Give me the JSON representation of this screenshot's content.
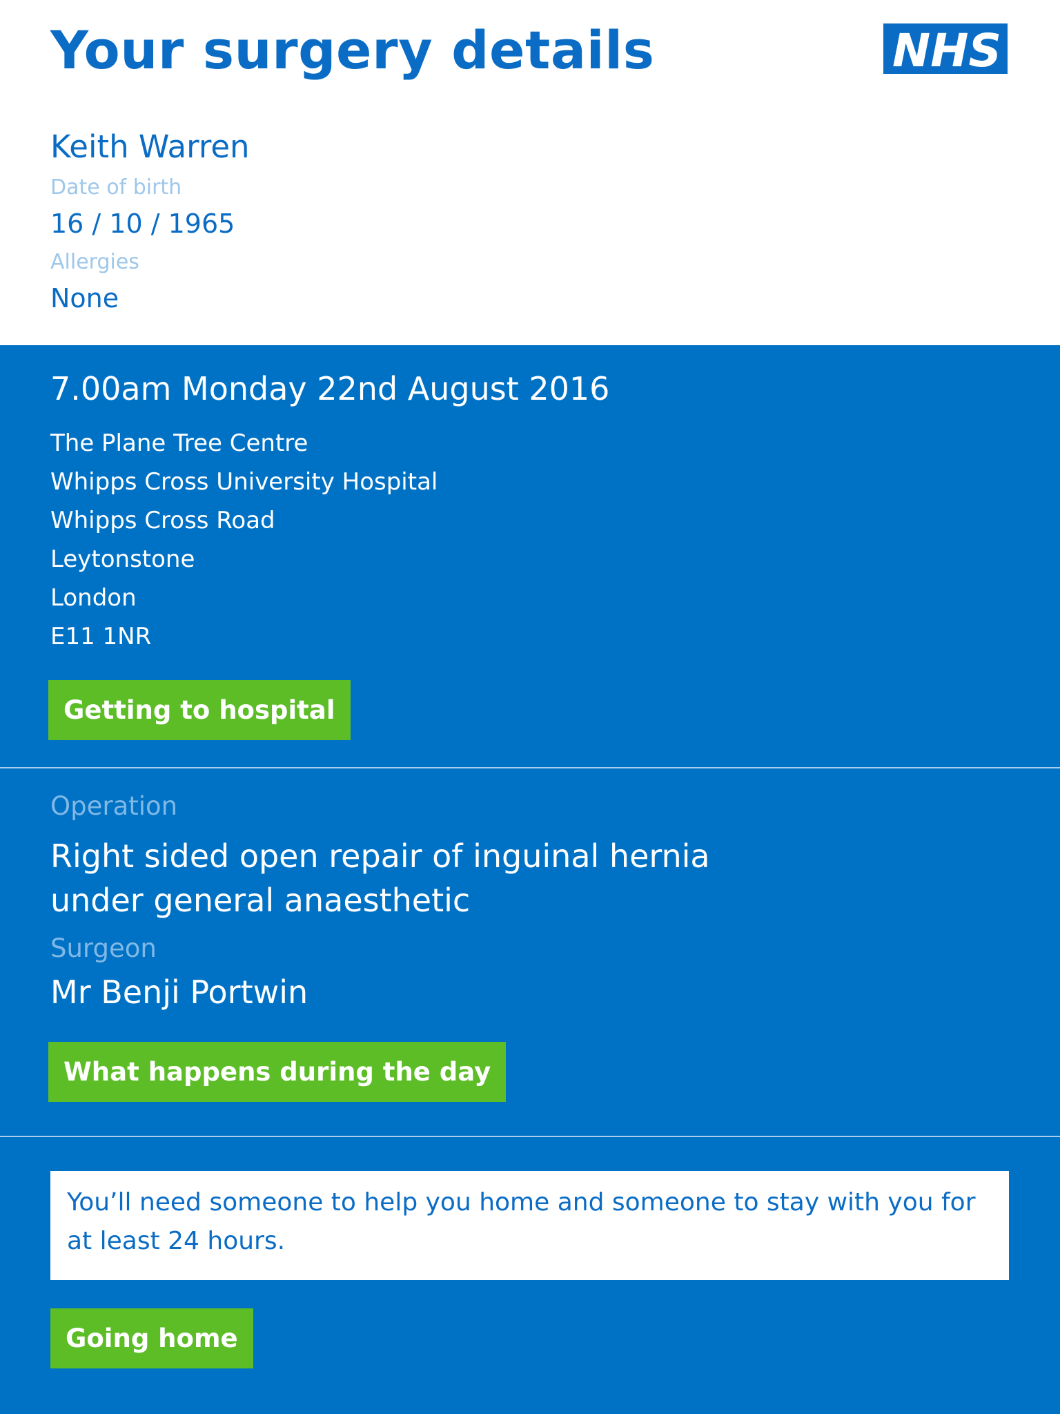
{
  "header": {
    "title": "Your surgery details",
    "logo_text": "NHS"
  },
  "patient": {
    "name": "Keith Warren",
    "dob_label": "Date of birth",
    "dob_value": "16 / 10 / 1965",
    "allergies_label": "Allergies",
    "allergies_value": "None"
  },
  "appointment": {
    "datetime": "7.00am Monday 22nd August 2016",
    "address": [
      "The Plane Tree Centre",
      "Whipps Cross University Hospital",
      "Whipps Cross Road",
      "Leytonstone",
      "London",
      "E11 1NR"
    ],
    "button_label": "Getting to hospital"
  },
  "operation": {
    "label": "Operation",
    "name": "Right sided open repair of inguinal hernia under general anaesthetic",
    "surgeon_label": "Surgeon",
    "surgeon_name": "Mr Benji Portwin",
    "button_label": "What happens during the day"
  },
  "going_home": {
    "notice": "You’ll need someone to help you home and someone to stay with you for at least 24 hours.",
    "button_label": "Going home"
  },
  "colors": {
    "nhs_blue": "#0072c6",
    "button_green": "#5cbd27",
    "header_bg": "#ffffff"
  }
}
